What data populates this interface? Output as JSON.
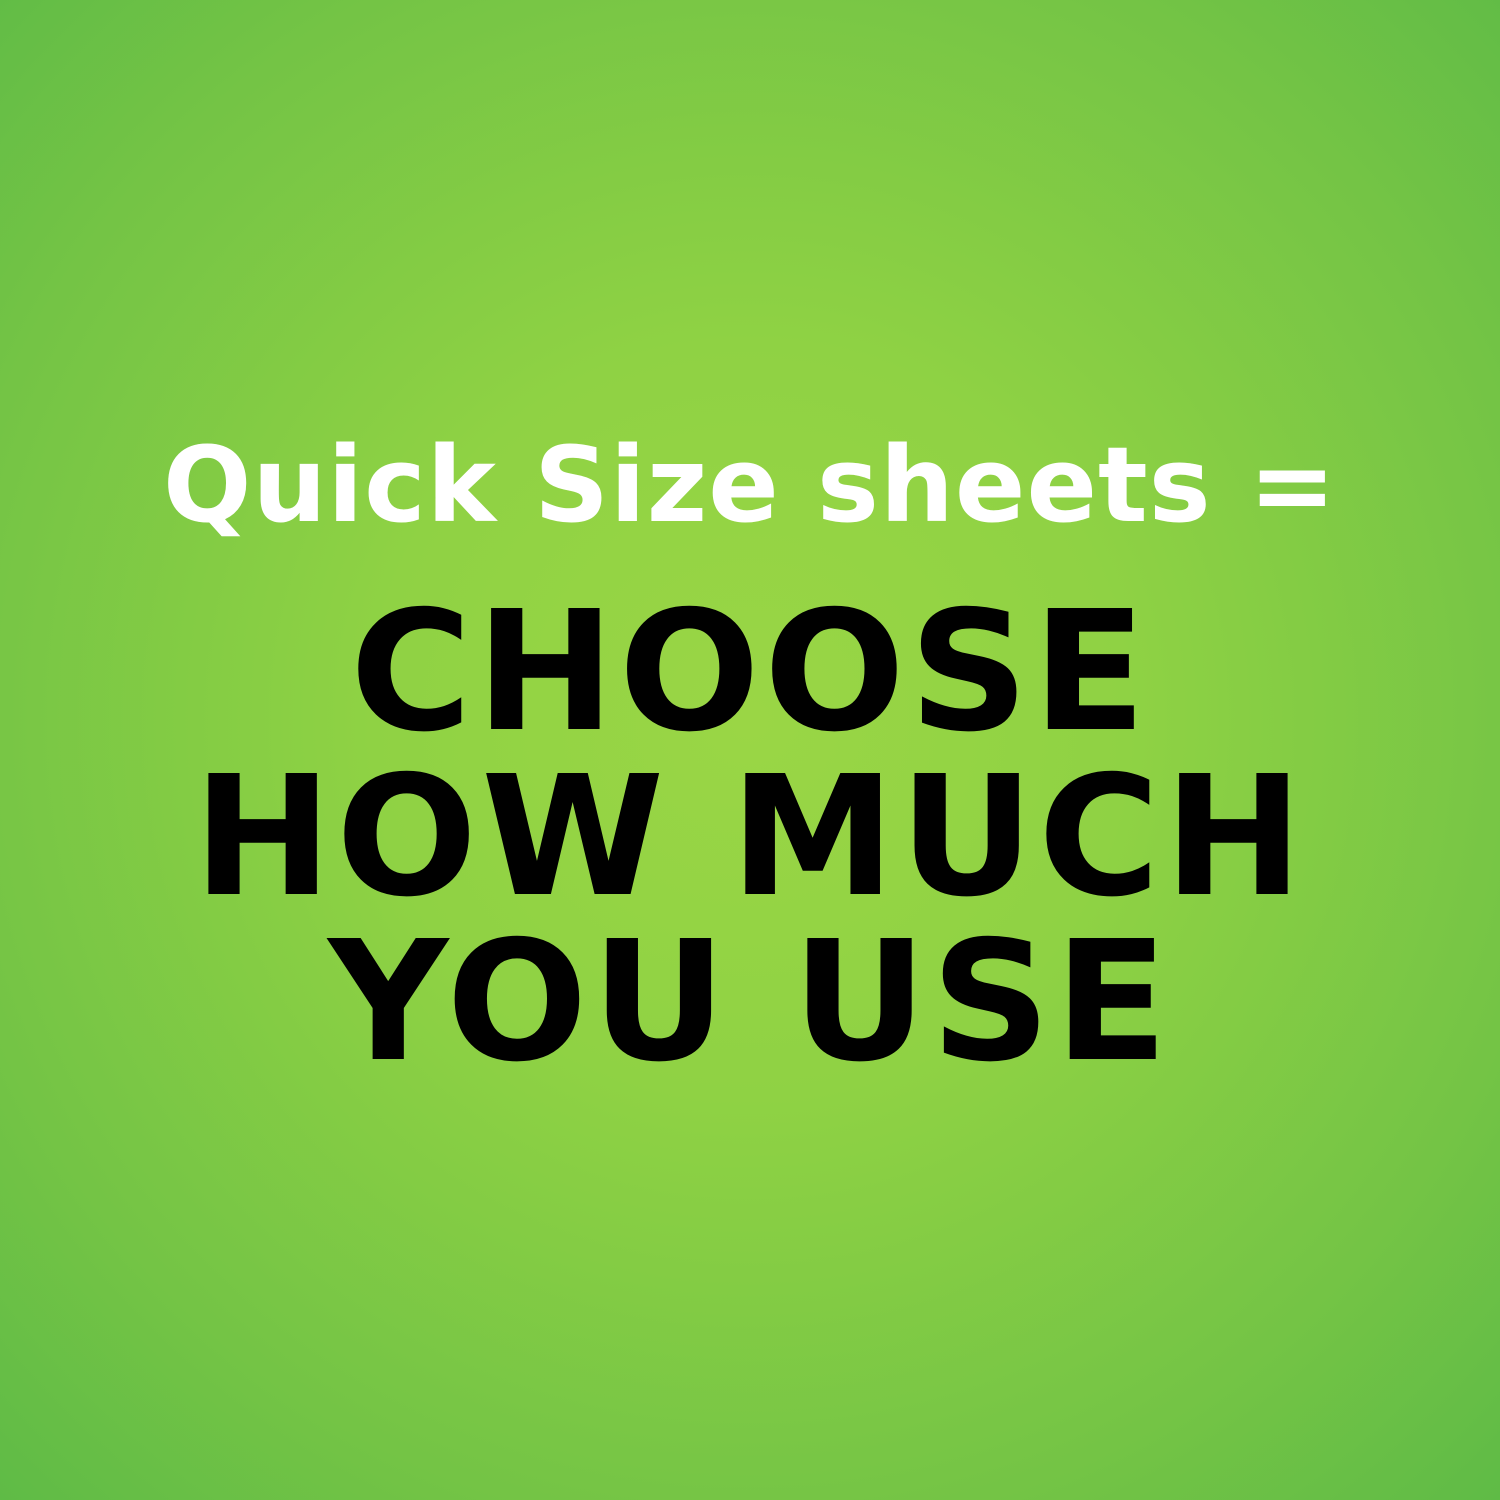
{
  "headline": "Quick Size sheets =",
  "tagline": {
    "line1": "CHOOSE",
    "line2": "HOW MUCH",
    "line3": "YOU USE"
  },
  "colors": {
    "background_center": "#9ad645",
    "background_edge": "#5fbb46",
    "headline_text": "#ffffff",
    "tagline_text": "#000000"
  }
}
